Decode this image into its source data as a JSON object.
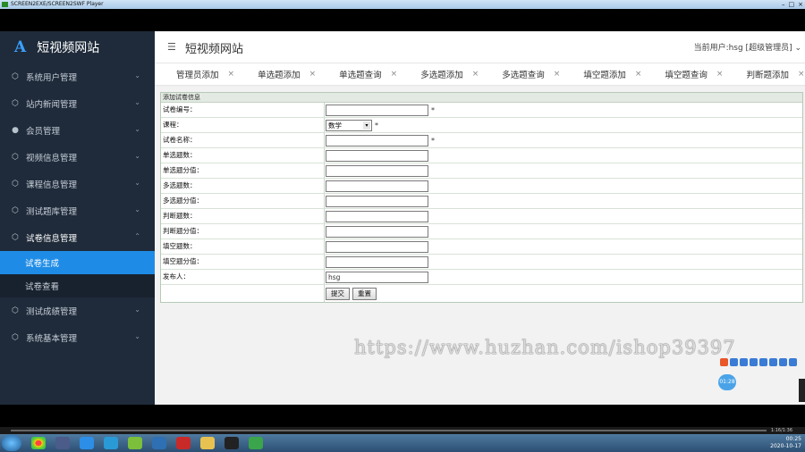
{
  "player": {
    "title": "SCREEN2EXE/SCREEN2SWF Player",
    "time": "1:16/1:36"
  },
  "sidebar": {
    "brand_logo": "A",
    "brand_title": "短视频网站",
    "items": [
      {
        "label": "系统用户管理",
        "icon": "cube-icon",
        "chev": "⌄"
      },
      {
        "label": "站内新闻管理",
        "icon": "cube-icon",
        "chev": "⌄"
      },
      {
        "label": "会员管理",
        "icon": "user-icon",
        "chev": "⌄"
      },
      {
        "label": "视频信息管理",
        "icon": "cube-icon",
        "chev": "⌄"
      },
      {
        "label": "课程信息管理",
        "icon": "cube-icon",
        "chev": "⌄"
      },
      {
        "label": "测试题库管理",
        "icon": "cube-icon",
        "chev": "⌄"
      },
      {
        "label": "试卷信息管理",
        "icon": "cube-icon",
        "chev": "⌃"
      },
      {
        "label": "测试成绩管理",
        "icon": "cube-icon",
        "chev": "⌄"
      },
      {
        "label": "系统基本管理",
        "icon": "cube-icon",
        "chev": "⌄"
      }
    ],
    "sub_items": [
      {
        "label": "试卷生成"
      },
      {
        "label": "试卷查看"
      }
    ]
  },
  "header": {
    "site_title": "短视频网站",
    "user_info": "当前用户:hsg [超级管理员] ⌄"
  },
  "tabs": [
    {
      "label": "管理员添加"
    },
    {
      "label": "单选题添加"
    },
    {
      "label": "单选题查询"
    },
    {
      "label": "多选题添加"
    },
    {
      "label": "多选题查询"
    },
    {
      "label": "填空题添加"
    },
    {
      "label": "填空题查询"
    },
    {
      "label": "判断题添加"
    },
    {
      "label": "判断"
    }
  ],
  "form": {
    "title": "添加试卷信息",
    "fields": [
      {
        "label": "试卷编号：",
        "value": "",
        "required": "*"
      },
      {
        "label": "课程：",
        "value": "数学",
        "required": "*"
      },
      {
        "label": "试卷名称：",
        "value": "",
        "required": "*"
      },
      {
        "label": "单选题数：",
        "value": ""
      },
      {
        "label": "单选题分值：",
        "value": ""
      },
      {
        "label": "多选题数：",
        "value": ""
      },
      {
        "label": "多选题分值：",
        "value": ""
      },
      {
        "label": "判断题数：",
        "value": ""
      },
      {
        "label": "判断题分值：",
        "value": ""
      },
      {
        "label": "填空题数：",
        "value": ""
      },
      {
        "label": "填空题分值：",
        "value": ""
      },
      {
        "label": "发布人：",
        "value": "hsg"
      }
    ],
    "submit_label": "提交",
    "reset_label": "重置"
  },
  "watermark": "https://www.huzhan.com/ishop39397",
  "clock_badge": "01:28",
  "tray": {
    "time": "00:25",
    "date": "2020-10-17"
  }
}
